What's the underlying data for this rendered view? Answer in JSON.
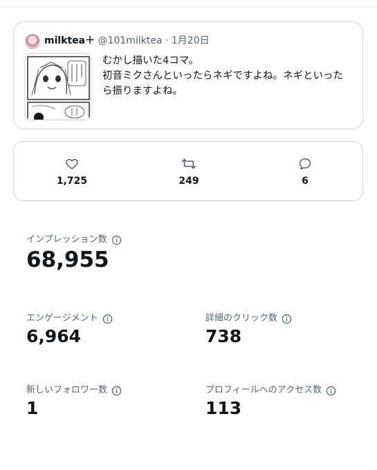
{
  "tweet": {
    "display_name": "milktea＋",
    "handle": "@101milktea",
    "separator": "·",
    "date": "1月20日",
    "text": "むかし描いた4コマ。\n初音ミクさんといったらネギですよね。ネギといったら振りますよね。"
  },
  "engagement": {
    "likes": "1,725",
    "retweets": "249",
    "replies": "6"
  },
  "stats": {
    "impressions": {
      "label": "インプレッション数",
      "value": "68,955"
    },
    "engagements": {
      "label": "エンゲージメント",
      "value": "6,964"
    },
    "detail_clicks": {
      "label": "詳細のクリック数",
      "value": "738"
    },
    "new_followers": {
      "label": "新しいフォロワー数",
      "value": "1"
    },
    "profile_visits": {
      "label": "プロフィールへのアクセス数",
      "value": "113"
    }
  },
  "colors": {
    "text_primary": "#0f1419",
    "text_secondary": "#536471",
    "border": "#cfd9de"
  }
}
